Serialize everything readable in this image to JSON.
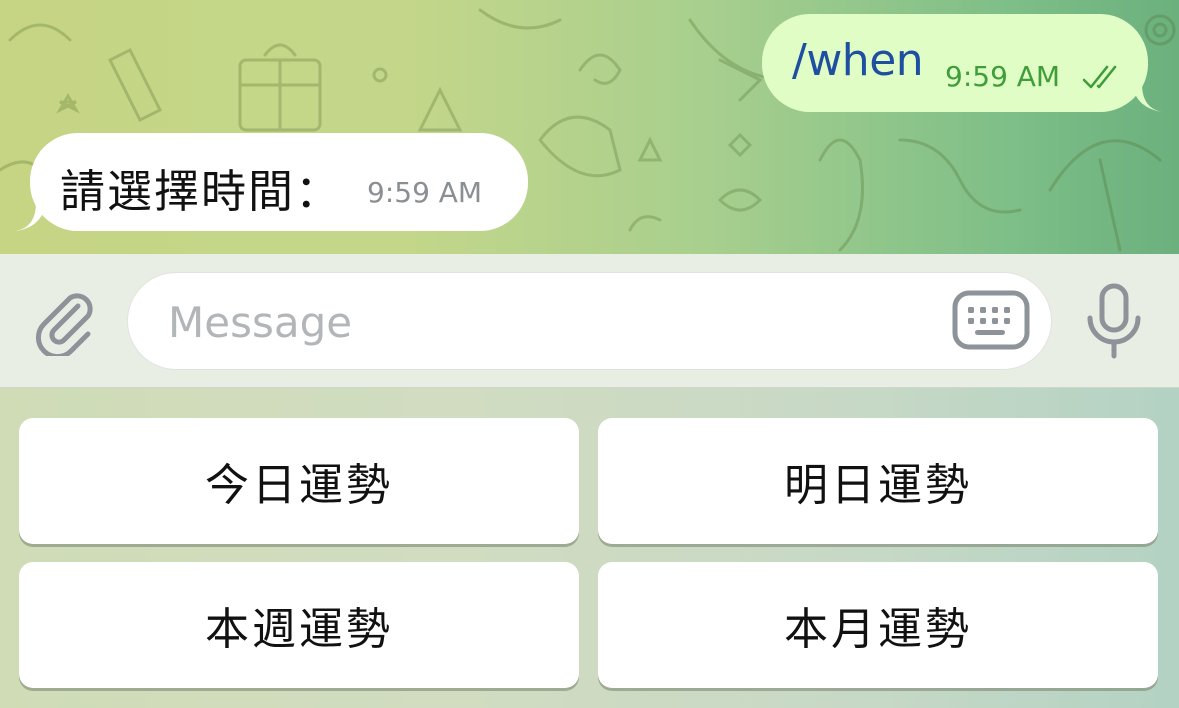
{
  "chat": {
    "outgoing": {
      "text": "/when",
      "time": "9:59 AM",
      "status_icon": "double-check-icon"
    },
    "incoming": {
      "text": "請選擇時間：",
      "time": "9:59 AM"
    }
  },
  "input_bar": {
    "placeholder": "Message",
    "attach_icon": "paperclip-icon",
    "keyboard_icon": "keyboard-icon",
    "mic_icon": "microphone-icon"
  },
  "reply_keyboard": {
    "buttons": [
      "今日運勢",
      "明日運勢",
      "本週運勢",
      "本月運勢"
    ]
  },
  "colors": {
    "outgoing_bubble": "#e1fdc6",
    "incoming_bubble": "#ffffff",
    "command_link": "#1f4fa0",
    "outgoing_time": "#3f9d3a",
    "icon_gray": "#8e9399"
  }
}
